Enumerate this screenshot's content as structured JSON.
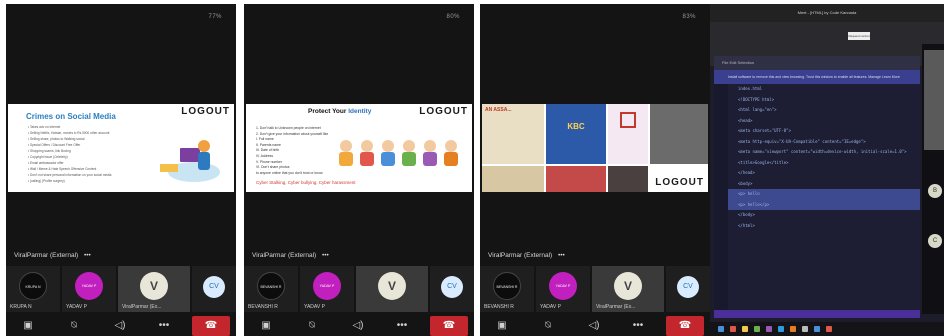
{
  "phones": [
    {
      "status": "77%",
      "slide": {
        "title": "Crimes on Social Media",
        "logo": "LOGOUT",
        "text_lines": [
          "Takes adv on internet",
          "Selling Netflix, Hotstar, movies in Rs.5000 other account",
          "Selling share, photos to Walking social",
          "Special Offers / Discount Free Offer",
          "Shopping scams, link Boxing",
          "Copyright Issue (Celebrity)",
          "Email ambassador offer",
          "Wall / Meme & Hate Speech Offensive Content",
          "Don't not share personal information on your social media",
          "(calling) (Profile surgery)"
        ]
      },
      "presenter": "ViralParmar (External)",
      "more_icon": "more-icon",
      "tiles": [
        {
          "avatar": "KRUPA N",
          "name": "KRUPA N",
          "style": "dark"
        },
        {
          "avatar": "YADAV P",
          "name": "YADAV P",
          "style": "pink"
        },
        {
          "avatar": "V",
          "name": "ViralParmar (Ex...",
          "style": "v"
        },
        {
          "avatar": "CV",
          "name": "",
          "style": "cv"
        }
      ]
    },
    {
      "status": "80%",
      "slide": {
        "title_part1": "Protect Your ",
        "title_part2": "Identity",
        "logo": "LOGOUT",
        "text_lines": [
          "1. Don't talk to Unknown people on internet",
          "2. Don't give your information about yourself like",
          "I. Full name",
          "II. Parents name",
          "III. Date of birth",
          "IV. Address",
          "V. Phone number",
          "VI. Don't share photos",
          "to anyone online that you don't trust or know."
        ],
        "red_text": "Cyber Stalking, Cyber bullying, Cyber harassment"
      },
      "presenter": "ViralParmar (External)",
      "tiles": [
        {
          "avatar": "BEVANSHI R",
          "name": "BEVANSHI R",
          "style": "dark"
        },
        {
          "avatar": "YADAV P",
          "name": "YADAV P",
          "style": "pink"
        },
        {
          "avatar": "V",
          "name": "",
          "style": "v"
        },
        {
          "avatar": "CV",
          "name": "",
          "style": "cv"
        }
      ]
    },
    {
      "status": "83%",
      "slide": {
        "logo": "LOGOUT",
        "collage_labels": [
          "KBC",
          "AN ASSA..."
        ]
      },
      "presenter": "ViralParmar (External)",
      "tiles": [
        {
          "avatar": "BEVANSHI R",
          "name": "BEVANSHI R",
          "style": "dark"
        },
        {
          "avatar": "YADAV P",
          "name": "YADAV P",
          "style": "pink"
        },
        {
          "avatar": "V",
          "name": "ViralParmar (Ex...",
          "style": "v"
        },
        {
          "avatar": "CV",
          "name": "",
          "style": "cv"
        }
      ]
    }
  ],
  "controls": {
    "camera_icon": "camera-off-icon",
    "mic_icon": "mic-off-icon",
    "speaker_icon": "speaker-icon",
    "more_icon": "more-icon",
    "hangup_icon": "hangup-icon"
  },
  "screen": {
    "title": "Meet - [HTML] by Code Kannada",
    "button_label": "Request control",
    "editor_top": "File  Edit  Selection",
    "notice": "Install software to remove this and view browsing. Trust this window to enable all features.  Manage  Learn More",
    "code_lines": [
      "index.html",
      "<!DOCTYPE html>",
      "<html lang=\"en\">",
      "<head>",
      "  <meta charset=\"UTF-8\">",
      "  <meta http-equiv=\"X-UA-Compatible\" content=\"IE=edge\">",
      "  <meta name=\"viewport\" content=\"width=device-width, initial-scale=1.0\">",
      "  <title>Google</title>",
      "</head>",
      "<body>",
      "  <p> hello",
      "  <p> hello</p>",
      "</body>",
      "</html>"
    ],
    "selected_lines": [
      10,
      11
    ],
    "side_labels": [
      "B",
      "C"
    ]
  },
  "colors": {
    "hangup": "#c4262e",
    "pink_avatar": "#c21fbf",
    "slide_accent": "#2b7fbf",
    "editor_bg": "#1d1e34",
    "selection": "#3e4a90"
  }
}
